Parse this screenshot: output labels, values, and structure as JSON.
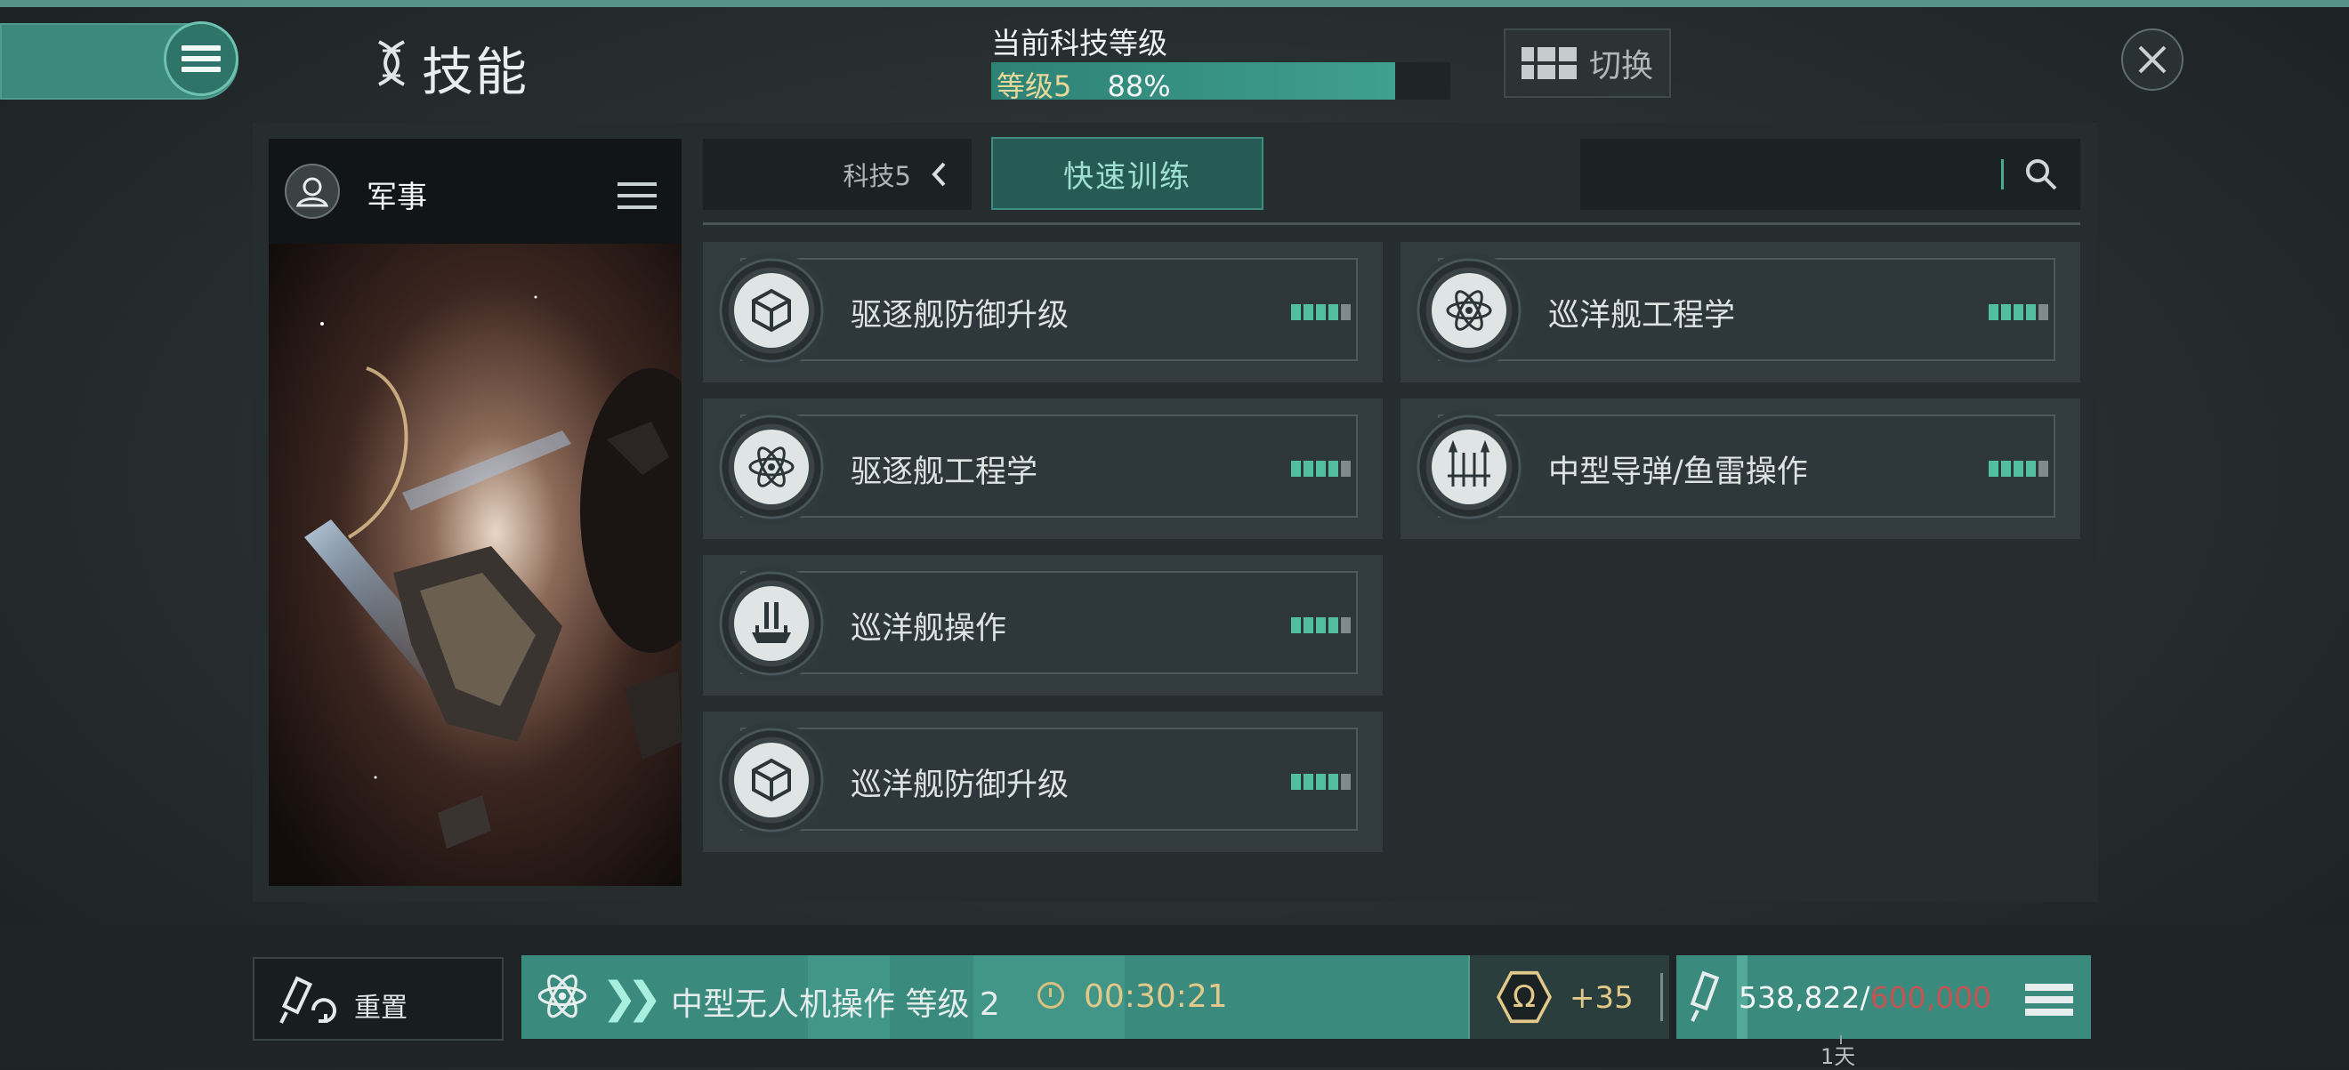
{
  "header": {
    "title": "技能",
    "tech_level": {
      "label": "当前科技等级",
      "level_text": "等级5",
      "percent_text": "88%",
      "progress": 0.88
    },
    "switch_label": "切换"
  },
  "left_card": {
    "title": "军事"
  },
  "tabs": {
    "dropdown_label": "科技5",
    "quick_train_label": "快速训练",
    "search_placeholder": ""
  },
  "skills": [
    {
      "name": "驱逐舰防御升级",
      "icon": "cube-icon",
      "level": 4,
      "max": 5
    },
    {
      "name": "巡洋舰工程学",
      "icon": "atom-icon",
      "level": 4,
      "max": 5
    },
    {
      "name": "驱逐舰工程学",
      "icon": "atom-icon",
      "level": 4,
      "max": 5
    },
    {
      "name": "中型导弹/鱼雷操作",
      "icon": "missiles-icon",
      "level": 4,
      "max": 5
    },
    {
      "name": "巡洋舰操作",
      "icon": "ship-icon",
      "level": 4,
      "max": 5
    },
    {
      "name": "巡洋舰防御升级",
      "icon": "cube-icon",
      "level": 4,
      "max": 5
    }
  ],
  "bottom": {
    "reset_label": "重置",
    "training_name": "中型无人机操作 等级 2",
    "training_time": "00:30:21",
    "omega_bonus": "+35",
    "skill_points": "538,822/",
    "skill_points_max": "600,000",
    "day_label": "1天"
  },
  "colors": {
    "accent": "#3a8a7d",
    "pip_on": "#52bfa2",
    "gold": "#e2c98a",
    "warning_red": "#c25454"
  }
}
